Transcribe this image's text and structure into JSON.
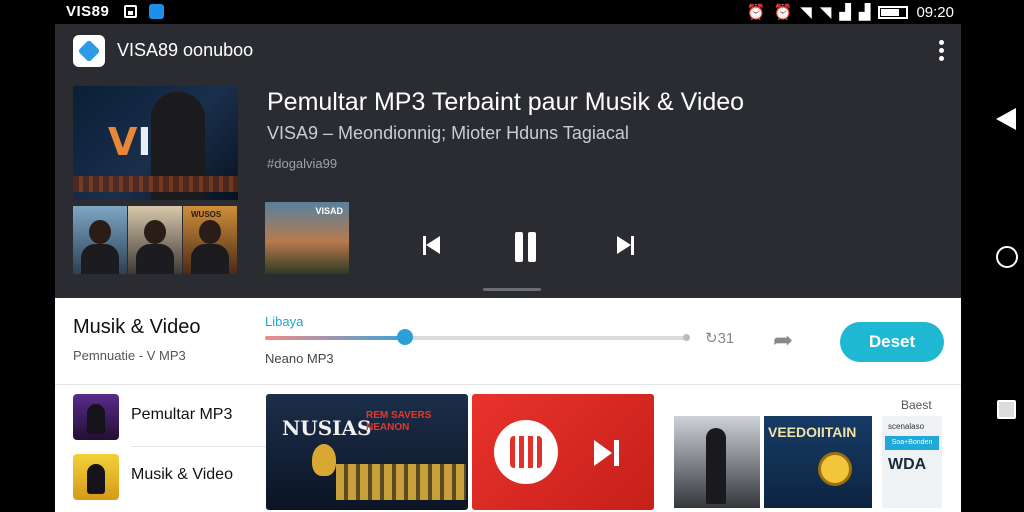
{
  "status_bar": {
    "brand": "VIS89",
    "time": "09:20",
    "icons": [
      "gallery-icon",
      "app-icon",
      "alarm-icon",
      "alarm-icon",
      "wifi-icon",
      "wifi-icon",
      "signal-icon",
      "signal-icon",
      "battery-icon"
    ]
  },
  "app": {
    "title": "VISA89 oonuboo",
    "menu_icon": "kebab-menu-icon"
  },
  "player": {
    "title": "Pemultar MP3 Terbaint paur Musik & Video",
    "subtitle": "VISA9 – Meondionnig; Mioter Hduns Tagiacal",
    "meta": "#dogalvia99",
    "main_art_text": "VI",
    "thumb_label": "WUSOS",
    "small_art_label": "VISAD",
    "controls": [
      "previous-icon",
      "pause-icon",
      "next-icon"
    ]
  },
  "now_playing": {
    "title": "Musik & Video",
    "subtitle": "Pemnuatie - V MP3",
    "progress_tag": "Libaya",
    "progress": 0.33,
    "progress_note": "Neano MP3",
    "repeat_label": "↻31",
    "share_icon": "share-icon",
    "cta_label": "Deset"
  },
  "list": [
    {
      "label": "Pemultar MP3"
    },
    {
      "label": "Musik & Video"
    }
  ],
  "cards": {
    "card1_title": "NUSIAS",
    "card1_red": "REM SAVERS NEANON",
    "tab_label": "Baest",
    "tile2_label": "VEEDOIITAIN",
    "tile3_top": "scenalaso",
    "tile3_band": "Soa+Bonden",
    "tile3_big": "WDA"
  },
  "colors": {
    "accent": "#1fb8d3",
    "progress_knob": "#2c9fd6",
    "app_bg": "#2a2c31",
    "panel_bg": "#ffffff",
    "red_card": "#e8332b"
  }
}
